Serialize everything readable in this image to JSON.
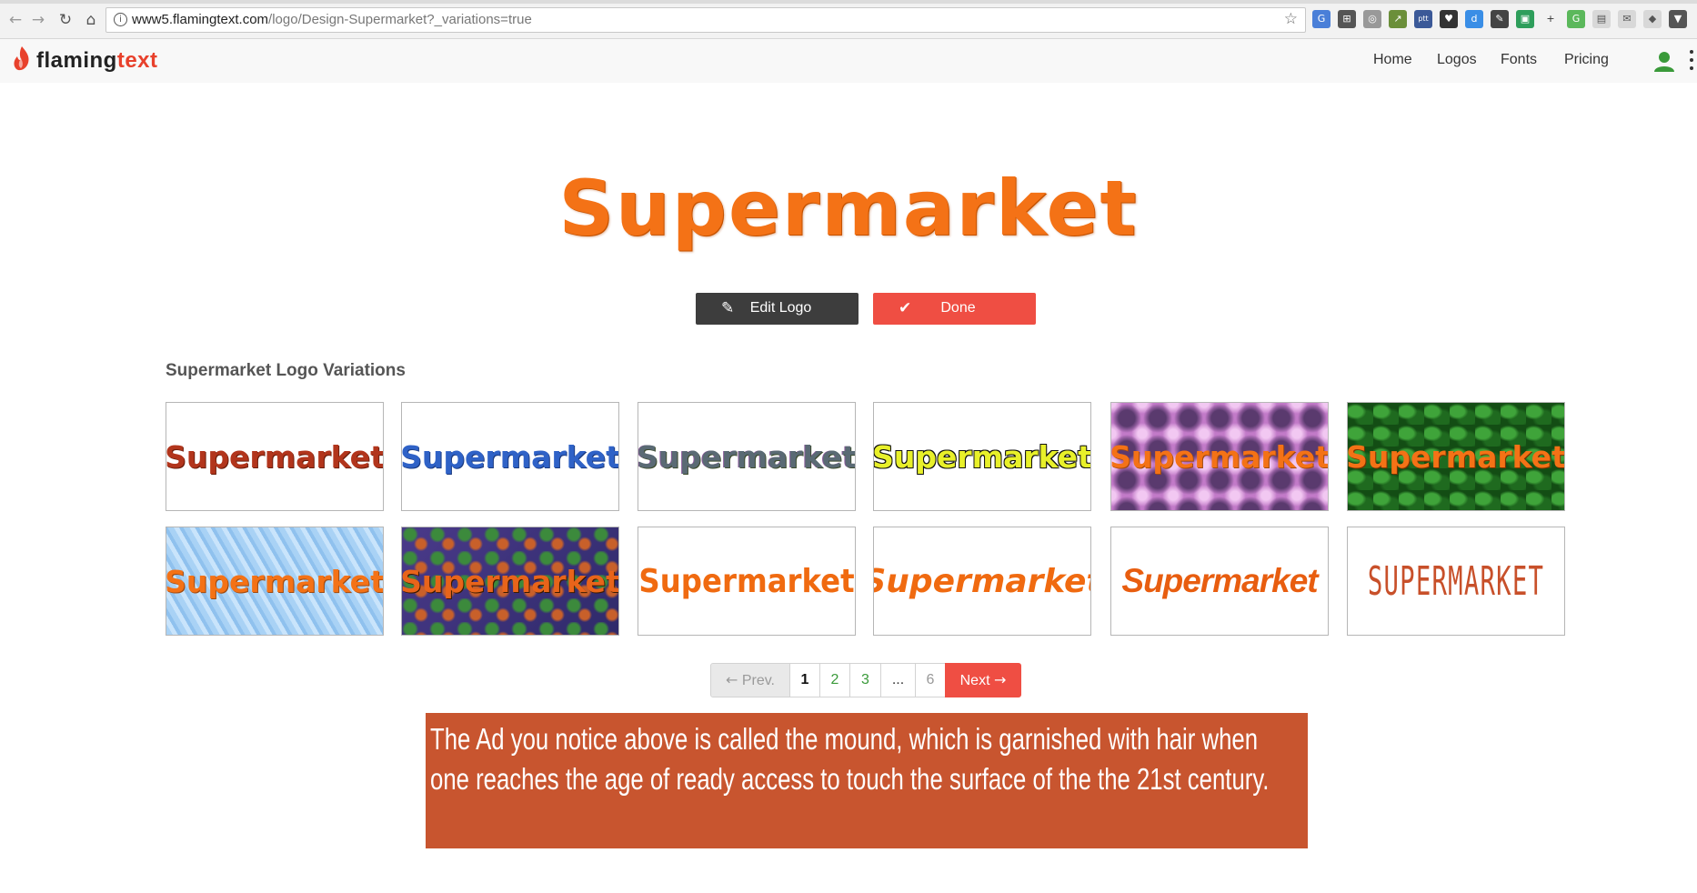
{
  "browser": {
    "url_host": "www5.flamingtext.com",
    "url_path": "/logo/Design-Supermarket?_variations=true"
  },
  "site": {
    "brand_part1": "flaming",
    "brand_part2": "text",
    "nav": [
      "Home",
      "Logos",
      "Fonts",
      "Pricing"
    ]
  },
  "main": {
    "title": "Supermarket",
    "edit_label": "Edit Logo",
    "done_label": "Done",
    "variations_heading": "Supermarket Logo Variations",
    "tiles": [
      {
        "text": "Supermarket",
        "style": "red-texture"
      },
      {
        "text": "Supermarket",
        "style": "blue-gradient"
      },
      {
        "text": "Supermarket",
        "style": "multicolor"
      },
      {
        "text": "Supermarket",
        "style": "yellow-striped"
      },
      {
        "text": "Supermarket",
        "style": "pink-dots-bg"
      },
      {
        "text": "Supermarket",
        "style": "leaf-bg"
      },
      {
        "text": "Supermarket",
        "style": "water-bg"
      },
      {
        "text": "Supermarket",
        "style": "mosaic-bg"
      },
      {
        "text": "Supermarket",
        "style": "orange-plain"
      },
      {
        "text": "Supermarket",
        "style": "orange-italic"
      },
      {
        "text": "Supermarket",
        "style": "orange-bold-italic"
      },
      {
        "text": "SUPERMARKET",
        "style": "thin-condensed"
      }
    ]
  },
  "pagination": {
    "prev_label": "Prev.",
    "pages": [
      "1",
      "2",
      "3",
      "...",
      "6"
    ],
    "current": "1",
    "next_label": "Next"
  },
  "ad": {
    "text": "The Ad you notice above is called the mound, which is garnished with hair when one reaches the age of ready access to touch the surface of the the 21st century."
  },
  "colors": {
    "brand_orange": "#f47216",
    "done_red": "#ef4e43",
    "edit_dark": "#3d3d3d",
    "ad_bg": "#c8552f",
    "page_link_green": "#3a9a3a"
  }
}
